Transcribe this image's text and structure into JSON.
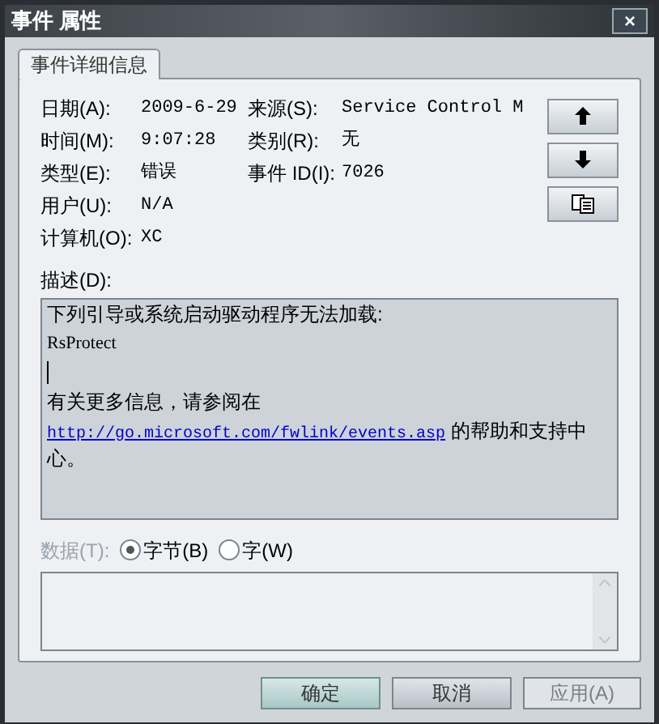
{
  "window": {
    "title": "事件 属性",
    "close": "×"
  },
  "tabs": [
    {
      "label": "事件详细信息",
      "selected": true
    }
  ],
  "details": [
    {
      "label": "日期(A):",
      "value": "2009-6-29",
      "label2": "来源(S):",
      "value2": "Service Control M"
    },
    {
      "label": "时间(M):",
      "value": "9:07:28",
      "label2": "类别(R):",
      "value2": "无"
    },
    {
      "label": "类型(E):",
      "value": "错误",
      "label2": "事件 ID(I):",
      "value2": "7026"
    },
    {
      "label": "用户(U):",
      "value": "N/A"
    },
    {
      "label": "计算机(O):",
      "value": "XC"
    }
  ],
  "side_buttons": [
    {
      "kind": "up"
    },
    {
      "kind": "down"
    },
    {
      "kind": "copy"
    }
  ],
  "description": {
    "label": "描述(D):",
    "lines": [
      {
        "kind": "text",
        "text": "下列引导或系统启动驱动程序无法加载:"
      },
      {
        "kind": "mono",
        "text": "RsProtect"
      },
      {
        "kind": "cursor"
      },
      {
        "kind": "text",
        "text": "有关更多信息，请参阅在"
      },
      {
        "kind": "link",
        "link": "http://go.microsoft.com/fwlink/events.asp",
        "text": " 的帮助和支持中心。"
      }
    ]
  },
  "data": {
    "label": "数据(T):",
    "disabled": true,
    "options": [
      {
        "label": "字节(B)",
        "selected": true
      },
      {
        "label": "字(W)",
        "selected": false
      }
    ]
  },
  "buttons": [
    {
      "label": "确定",
      "disabled": false,
      "default": true
    },
    {
      "label": "取消",
      "disabled": false,
      "default": false
    },
    {
      "label": "应用(A)",
      "disabled": true,
      "default": false
    }
  ]
}
